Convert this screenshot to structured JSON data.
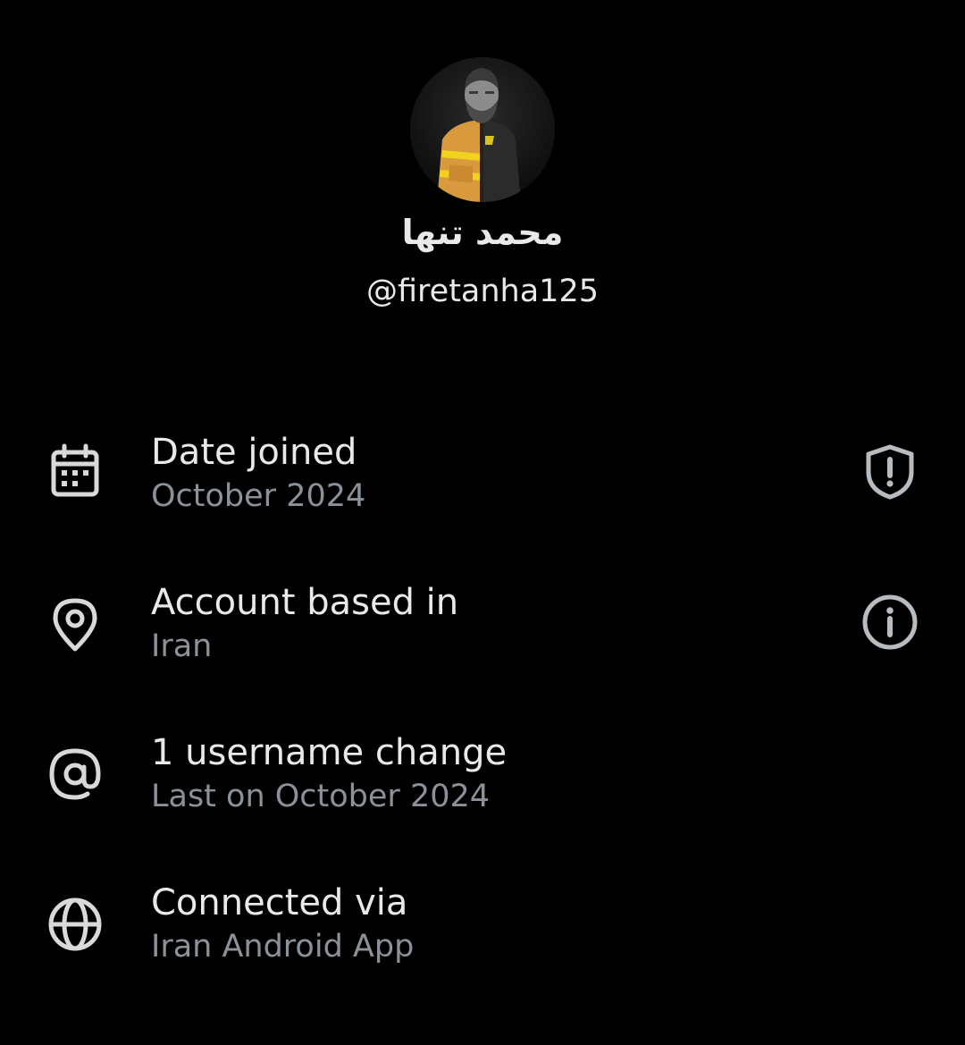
{
  "profile": {
    "display_name": "محمد تنها",
    "handle": "@firetanha125"
  },
  "rows": [
    {
      "icon": "calendar-icon",
      "title": "Date joined",
      "subtitle": "October 2024",
      "action_icon": "shield-alert-icon"
    },
    {
      "icon": "location-pin-icon",
      "title": "Account based in",
      "subtitle": "Iran",
      "action_icon": "info-icon"
    },
    {
      "icon": "at-sign-icon",
      "title": "1 username change",
      "subtitle": "Last on October 2024"
    },
    {
      "icon": "globe-icon",
      "title": "Connected via",
      "subtitle": "Iran Android App"
    }
  ],
  "colors": {
    "background": "#000000",
    "primary_text": "#e7e9ea",
    "secondary_text": "#8b9198",
    "icon": "#d9d9d9",
    "action_icon": "#b7bcc1"
  }
}
